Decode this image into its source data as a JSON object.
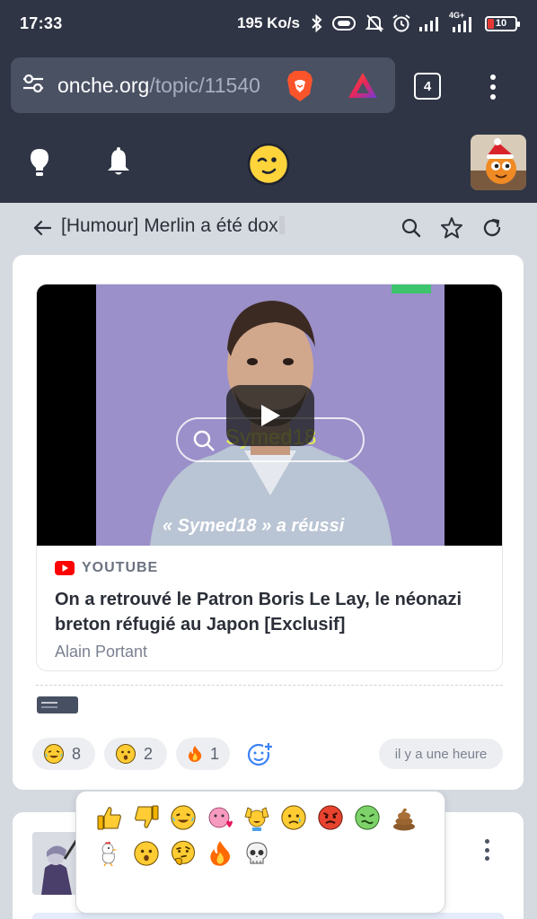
{
  "status_bar": {
    "time": "17:33",
    "speed": "195 Ko/s",
    "network": "4G+",
    "battery": "10",
    "icons": [
      "bluetooth-icon",
      "vibrate-icon",
      "mute-icon",
      "alarm-icon",
      "signal-icon",
      "battery-icon"
    ]
  },
  "browser": {
    "url_host": "onche.org",
    "url_path": "/topic/11540",
    "tab_count": "4",
    "icons": [
      "site-settings-icon",
      "brave-shield-icon",
      "brave-rewards-icon",
      "tabs-icon",
      "more-menu-icon"
    ]
  },
  "site_header": {
    "icons": [
      "lightbulb-icon",
      "bell-icon",
      "onche-logo-icon",
      "user-avatar"
    ]
  },
  "topic": {
    "title": "[Humour] Merlin a été dox",
    "icons": [
      "back-arrow-icon",
      "search-icon",
      "star-icon",
      "refresh-icon"
    ]
  },
  "post": {
    "embed": {
      "source": "YOUTUBE",
      "title": "On a retrouvé le Patron Boris Le Lay, le néonazi breton réfugié au Japon [Exclusif]",
      "author": "Alain Portant",
      "video_caption": "« Symed18 » a réussi",
      "video_search_text": "Symed18"
    },
    "reactions": [
      {
        "emoji": "laughing-tears-emoji",
        "count": "8"
      },
      {
        "emoji": "surprised-emoji",
        "count": "2"
      },
      {
        "emoji": "fire-emoji",
        "count": "1"
      }
    ],
    "timestamp": "il y a une heure"
  },
  "emoji_picker": {
    "emojis": [
      "thumbs-up-emoji",
      "thumbs-down-emoji",
      "laughing-tears-emoji",
      "pink-heart-face-emoji",
      "hands-up-emoji",
      "sad-emoji",
      "angry-emoji",
      "sick-emoji",
      "poop-emoji",
      "chicken-emoji",
      "surprised-emoji",
      "thinking-emoji",
      "fire-emoji",
      "skull-emoji"
    ]
  },
  "colors": {
    "header_bg": "#2f3545",
    "page_bg": "#d5d9e0",
    "youtube_red": "#ff0000",
    "brave_orange": "#fb542b"
  }
}
